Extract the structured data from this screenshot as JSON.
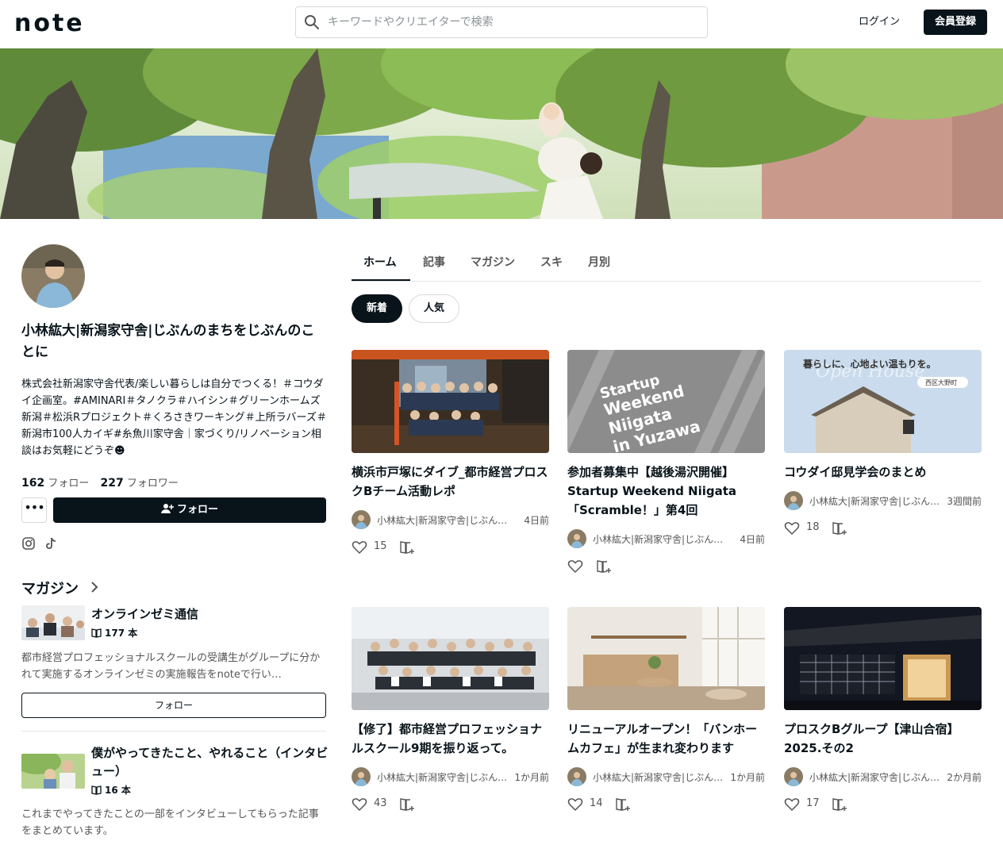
{
  "header": {
    "logo": "note",
    "search_placeholder": "キーワードやクリエイターで検索",
    "login": "ログイン",
    "signup": "会員登録"
  },
  "profile": {
    "name": "小林紘大|新潟家守舎|じぶんのまちをじぶんのことに",
    "bio": "株式会社新潟家守舎代表/楽しい暮らしは自分でつくる！＃コウダイ企画室。#AMINARI＃タノクラ＃ハイシン＃グリーンホームズ新潟＃松浜Rプロジェクト＃くろさきワーキング＃上所ラバーズ＃新潟市100人カイギ#糸魚川家守舎｜家づくり/リノベーション相談はお気軽にどうぞ☻",
    "follow_count": "162",
    "follow_label": "フォロー",
    "follower_count": "227",
    "follower_label": "フォロワー",
    "more_label": "•••",
    "follow_button": "フォロー"
  },
  "magazines": {
    "heading": "マガジン",
    "items": [
      {
        "title": "オンラインゼミ通信",
        "count": "177 本",
        "desc": "都市経営プロフェッショナルスクールの受講生がグループに分かれて実施するオンラインゼミの実施報告をnoteで行い…",
        "follow": "フォロー"
      },
      {
        "title": "僕がやってきたこと、やれること（インタビュー）",
        "count": "16 本",
        "desc": "これまでやってきたことの一部をインタビューしてもらった記事をまとめています。"
      }
    ]
  },
  "tabs": [
    "ホーム",
    "記事",
    "マガジン",
    "スキ",
    "月別"
  ],
  "filters": [
    "新着",
    "人気"
  ],
  "author_short": "小林紘大|新潟家守舎|じぶんのまちをじぶんのことに",
  "cards": [
    {
      "title": "横浜市戸塚にダイブ_都市経営プロスクBチーム活動レポ",
      "author": "小林紘大|新潟家守舎|じぶんの…",
      "time": "4日前",
      "likes": "15"
    },
    {
      "title": "参加者募集中【越後湯沢開催】Startup Weekend Niigata「Scramble！」第4回",
      "author": "小林紘大|新潟家守舎|じぶんの…",
      "time": "4日前",
      "likes": ""
    },
    {
      "title": "コウダイ邸見学会のまとめ",
      "author": "小林紘大|新潟家守舎|じぶん…",
      "time": "3週間前",
      "likes": "18"
    },
    {
      "title": "【修了】都市経営プロフェッショナルスクール9期を振り返って。",
      "author": "小林紘大|新潟家守舎|じぶん…",
      "time": "1か月前",
      "likes": "43"
    },
    {
      "title": "リニューアルオープン！「バンホームカフェ」が生まれ変わります",
      "author": "小林紘大|新潟家守舎|じぶん…",
      "time": "1か月前",
      "likes": "14"
    },
    {
      "title": "プロスクBグループ【津山合宿】2025.その2",
      "author": "小林紘大|新潟家守舎|じぶん…",
      "time": "2か月前",
      "likes": "17"
    }
  ],
  "thumb_texts": {
    "startup_line1": "Startup",
    "startup_line2": "Weekend",
    "startup_line3": "Niigata",
    "startup_line4": "in Yuzawa",
    "house_caption": "暮らしに、心地よい温もりを。",
    "house_tag": "西区大野町",
    "house_script": "Open House"
  },
  "colors": {
    "primary": "#08131a",
    "muted": "#555555",
    "border": "#d6d9dc"
  }
}
